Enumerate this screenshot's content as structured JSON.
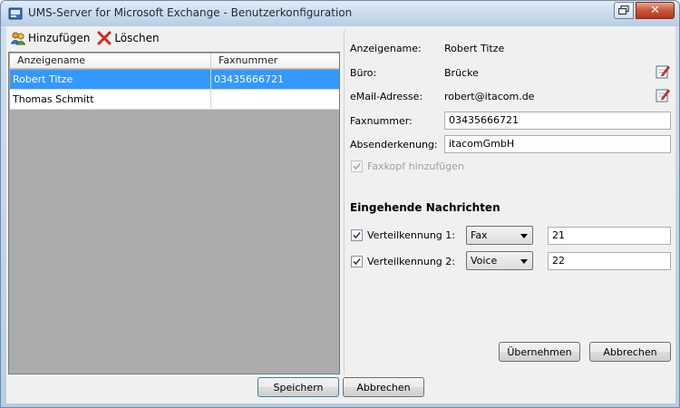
{
  "window": {
    "title": "UMS-Server for Microsoft Exchange - Benutzerkonfiguration",
    "close_glyph": "✕"
  },
  "toolbar": {
    "add_label": "Hinzufügen",
    "delete_label": "Löschen"
  },
  "grid": {
    "columns": [
      "Anzeigename",
      "Faxnummer"
    ],
    "rows": [
      {
        "name": "Robert Titze",
        "fax": "03435666721",
        "selected": true
      },
      {
        "name": "Thomas Schmitt",
        "fax": "",
        "selected": false
      }
    ]
  },
  "details": {
    "display_name_label": "Anzeigename:",
    "display_name_value": "Robert Titze",
    "office_label": "Büro:",
    "office_value": "Brücke",
    "email_label": "eMail-Adresse:",
    "email_value": "robert@itacom.de",
    "fax_label": "Faxnummer:",
    "fax_value": "03435666721",
    "sender_label": "Absenderkenung:",
    "sender_value": "itacomGmbH",
    "faxhead_label": "Faxkopf hinzufügen",
    "faxhead_checked": true,
    "faxhead_enabled": false
  },
  "incoming": {
    "title": "Eingehende Nachrichten",
    "rows": [
      {
        "label": "Verteilkennung 1:",
        "checked": true,
        "type": "Fax",
        "value": "21"
      },
      {
        "label": "Verteilkennung 2:",
        "checked": true,
        "type": "Voice",
        "value": "22"
      }
    ]
  },
  "buttons": {
    "apply": "Übernehmen",
    "cancel_right": "Abbrechen",
    "save": "Speichern",
    "cancel_bottom": "Abbrechen"
  },
  "colors": {
    "selection": "#3399ff",
    "grid_empty": "#ababab",
    "close_button": "#c8553a"
  }
}
